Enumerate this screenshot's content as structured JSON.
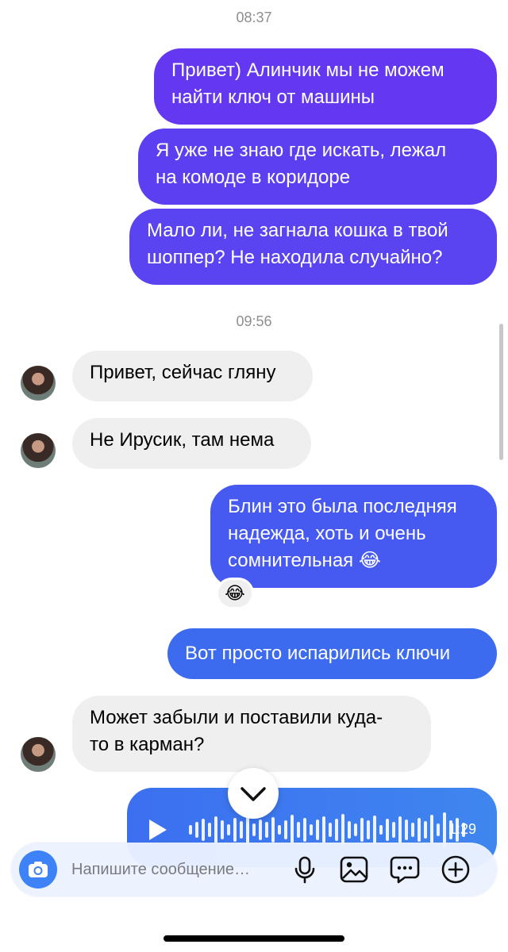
{
  "chat": {
    "timestamps": [
      "08:37",
      "09:56"
    ],
    "outgoing": [
      {
        "lines": [
          "Привет) Алинчик мы не можем",
          "найти ключ от машины"
        ]
      },
      {
        "lines": [
          "Я уже не знаю где искать, лежал",
          "на комоде в коридоре"
        ]
      },
      {
        "lines": [
          "Мало ли, не загнала кошка в твой",
          "шоппер? Не находила случайно?"
        ]
      },
      {
        "lines": [
          "Блин это была последняя",
          "надежда, хоть и очень",
          "сомнительная 😂"
        ],
        "reaction": "😂"
      },
      {
        "lines": [
          "Вот просто испарились ключи"
        ]
      }
    ],
    "incoming": [
      {
        "lines": [
          "Привет, сейчас гляну"
        ]
      },
      {
        "lines": [
          "Не Ирусик, там нема"
        ]
      },
      {
        "lines": [
          "Может забыли и поставили куда-",
          "то в карман?"
        ]
      }
    ],
    "voice_message": {
      "duration": "1:29"
    }
  },
  "composer": {
    "placeholder": "Напишите сообщение…"
  },
  "colors": {
    "bubble_out_top": "#6539f0",
    "bubble_out_bottom": "#3c6bef",
    "bubble_in": "#efefef",
    "accent": "#3d82f7"
  },
  "icons": [
    "camera-icon",
    "microphone-icon",
    "gallery-icon",
    "sticker-icon",
    "plus-icon",
    "chevron-down-icon",
    "play-icon"
  ]
}
